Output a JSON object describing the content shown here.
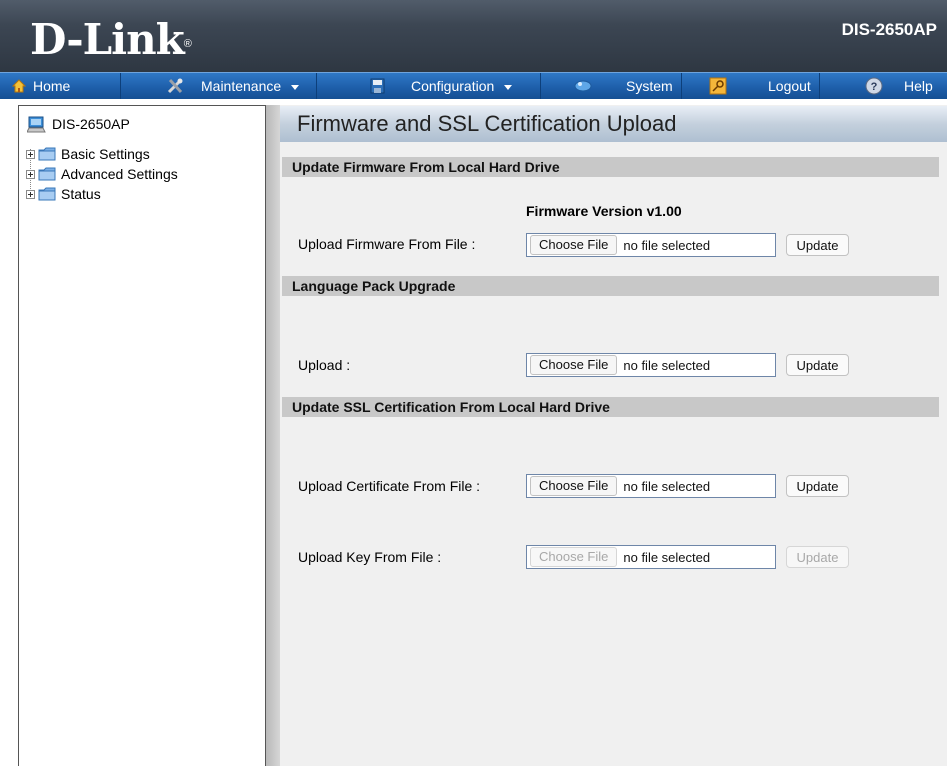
{
  "header": {
    "logo_text": "D-Link",
    "logo_mark": "®",
    "model": "DIS-2650AP"
  },
  "menu": {
    "home": "Home",
    "maintenance": "Maintenance",
    "configuration": "Configuration",
    "system": "System",
    "logout": "Logout",
    "help": "Help"
  },
  "icons": {
    "home": "home-icon",
    "maintenance": "tools-icon",
    "configuration": "floppy-disk-icon",
    "system": "network-icon",
    "logout": "key-icon",
    "help": "help-icon"
  },
  "sidebar": {
    "root": "DIS-2650AP",
    "items": [
      {
        "label": "Basic Settings"
      },
      {
        "label": "Advanced Settings"
      },
      {
        "label": "Status"
      }
    ]
  },
  "page": {
    "title": "Firmware and SSL Certification Upload",
    "sections": {
      "firmware": "Update Firmware From Local Hard Drive",
      "language": "Language Pack Upgrade",
      "ssl": "Update SSL Certification From Local Hard Drive"
    },
    "firmware_version": "Firmware Version v1.00",
    "rows": {
      "firmware": {
        "label": "Upload Firmware From File :",
        "choose": "Choose File",
        "status": "no file selected",
        "update": "Update"
      },
      "language": {
        "label": "Upload :",
        "choose": "Choose File",
        "status": "no file selected",
        "update": "Update"
      },
      "certificate": {
        "label": "Upload Certificate From File :",
        "choose": "Choose File",
        "status": "no file selected",
        "update": "Update"
      },
      "key": {
        "label": "Upload Key From File :",
        "choose": "Choose File",
        "status": "no file selected",
        "update": "Update",
        "disabled": true
      }
    }
  },
  "colors": {
    "header_bg": "#3c4653",
    "menubar_bg": "#1d5da8",
    "section_bar": "#c8c8c8",
    "panel_bg": "#f0f0f0"
  }
}
